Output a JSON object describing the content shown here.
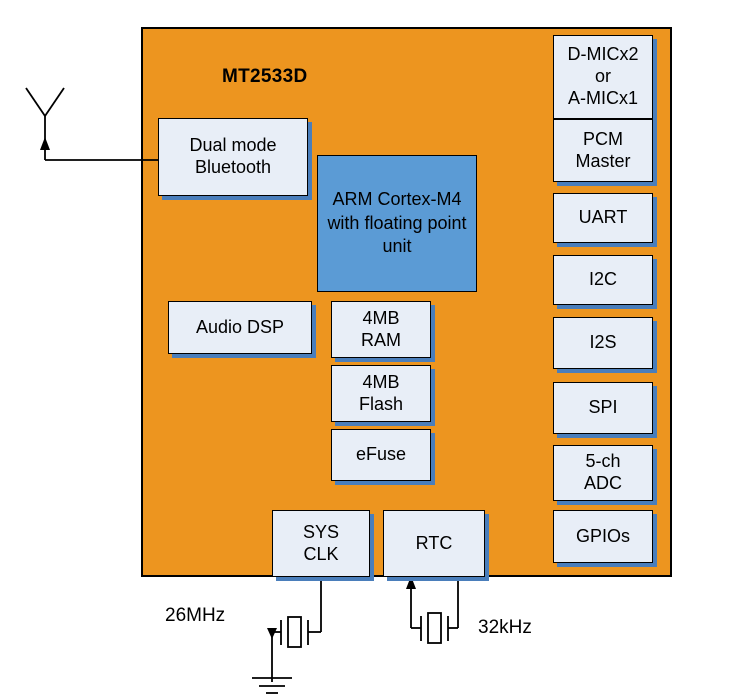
{
  "diagram": {
    "title": "MT2533D",
    "colors": {
      "chip_fill": "#ED951F",
      "block_fill": "#E8EEF7",
      "block_shadow": "#4A7EBB",
      "cpu_fill": "#5B9BD5",
      "stroke": "#000000"
    },
    "chip_blocks": {
      "bluetooth": {
        "line1": "Dual mode",
        "line2": "Bluetooth"
      },
      "cpu": {
        "line1": "ARM",
        "line2": "Cortex-M4",
        "line3": "with floating",
        "line4": "point unit"
      },
      "audio_dsp": {
        "line1": "Audio DSP"
      },
      "ram": {
        "line1": "4MB",
        "line2": "RAM"
      },
      "flash": {
        "line1": "4MB",
        "line2": "Flash"
      },
      "efuse": {
        "line1": "eFuse"
      },
      "sys_clk": {
        "line1": "SYS",
        "line2": "CLK"
      },
      "rtc": {
        "line1": "RTC"
      }
    },
    "peripherals": [
      {
        "id": "mic",
        "line1": "D-MICx2",
        "line2": "or",
        "line3": "A-MICx1"
      },
      {
        "id": "pcm",
        "line1": "PCM",
        "line2": "Master"
      },
      {
        "id": "uart",
        "line1": "UART"
      },
      {
        "id": "i2c",
        "line1": "I2C"
      },
      {
        "id": "i2s",
        "line1": "I2S"
      },
      {
        "id": "spi",
        "line1": "SPI"
      },
      {
        "id": "adc",
        "line1": "5-ch",
        "line2": "ADC"
      },
      {
        "id": "gpios",
        "line1": "GPIOs"
      }
    ],
    "external": {
      "antenna_label": "",
      "crystal_26mhz": "26MHz",
      "crystal_32khz": "32kHz"
    },
    "symbols": {
      "antenna": "antenna-icon",
      "crystal": "crystal-icon",
      "ground": "ground-icon"
    }
  }
}
